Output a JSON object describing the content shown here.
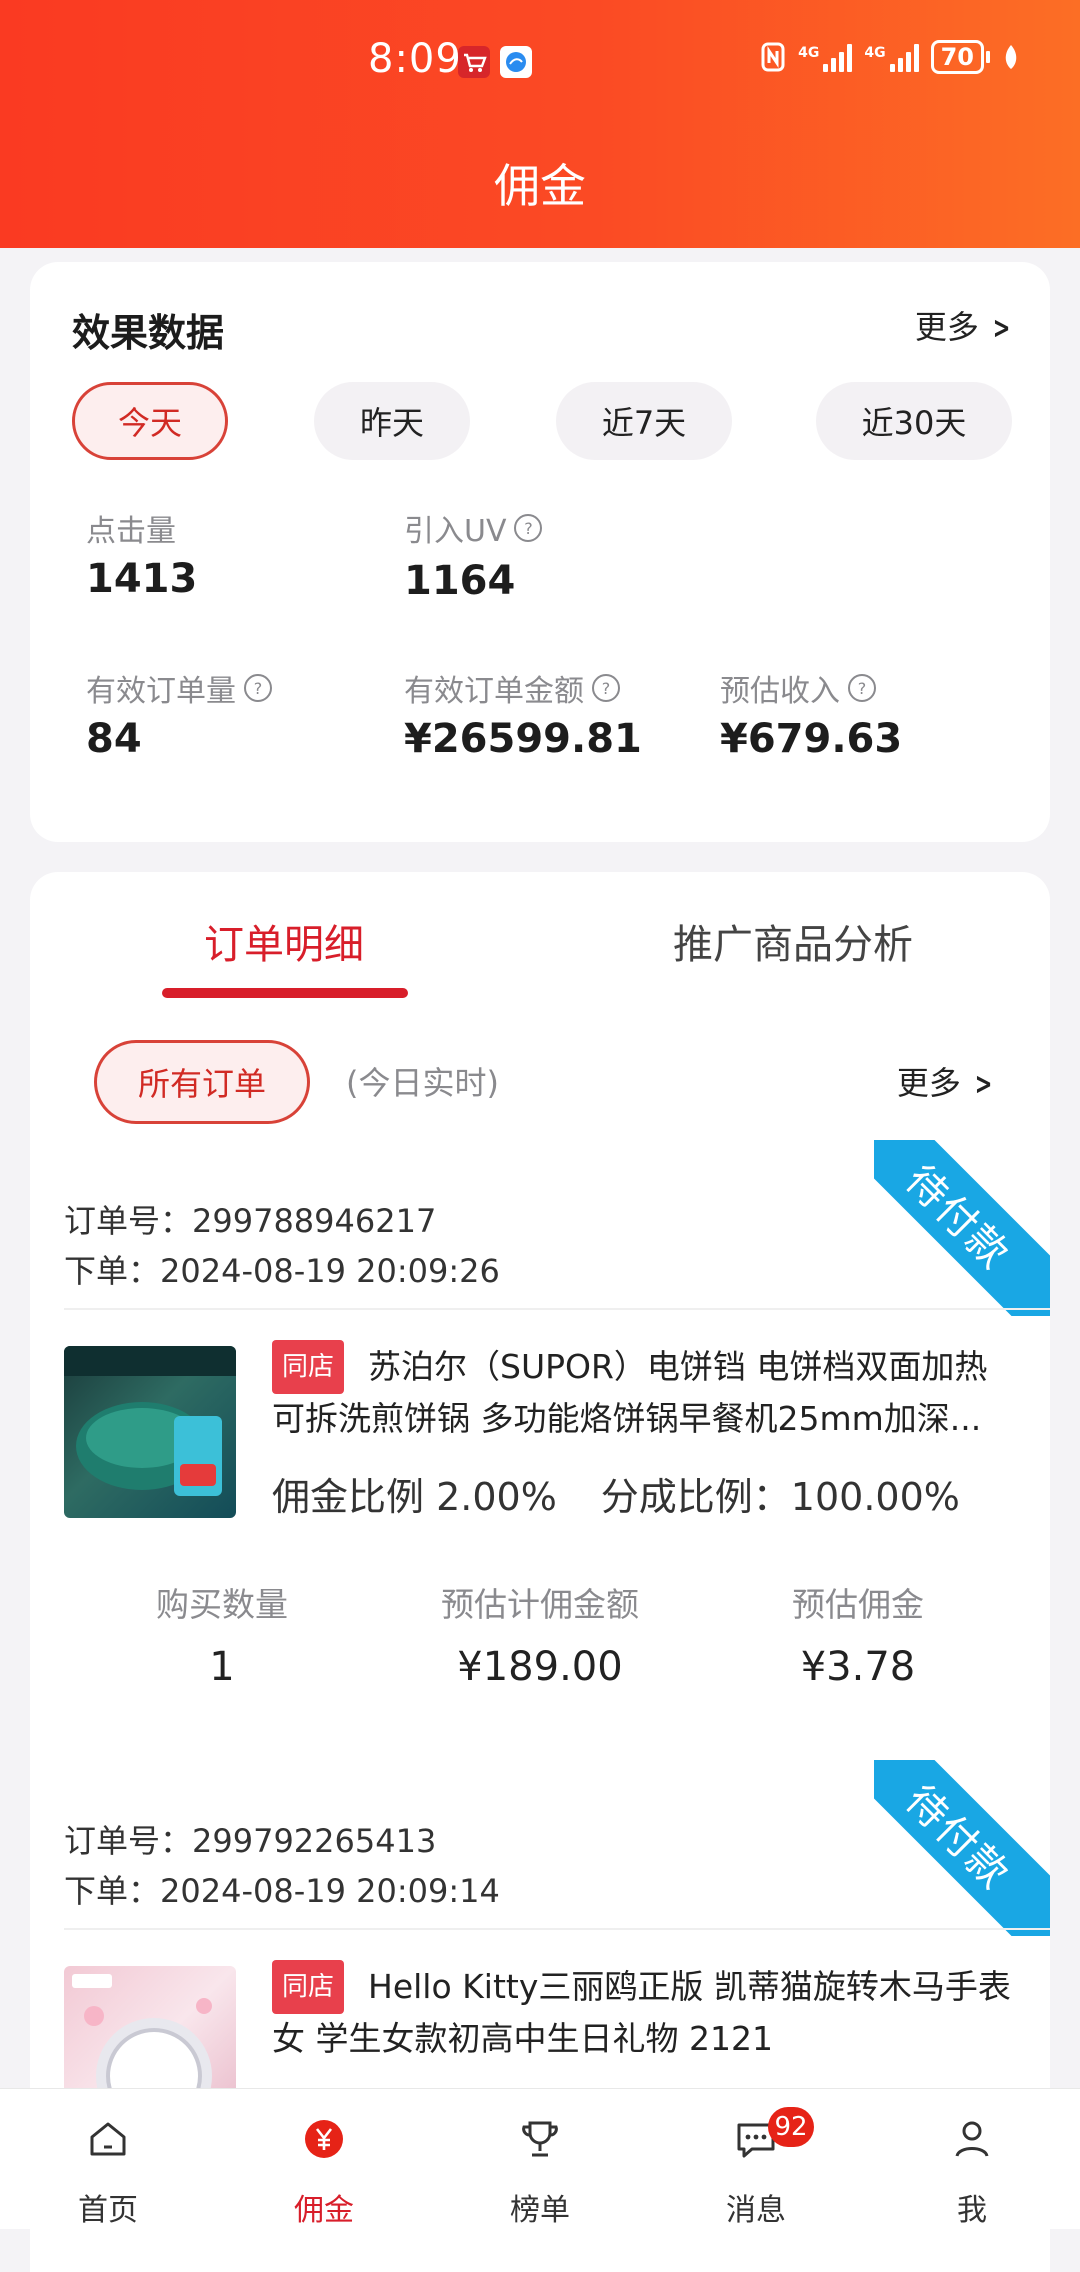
{
  "status_bar": {
    "time": "8:09",
    "battery": "70",
    "network_1": "4G",
    "network_2": "4G"
  },
  "page": {
    "title": "佣金"
  },
  "effect_card": {
    "title": "效果数据",
    "more": "更多",
    "periods": [
      "今天",
      "昨天",
      "近7天",
      "近30天"
    ],
    "selected_period": "今天",
    "stats": {
      "clicks": {
        "label": "点击量",
        "value": "1413"
      },
      "uv": {
        "label": "引入UV",
        "value": "1164"
      },
      "valid_orders": {
        "label": "有效订单量",
        "value": "84"
      },
      "valid_amount": {
        "label": "有效订单金额",
        "value": "¥26599.81"
      },
      "est_income": {
        "label": "预估收入",
        "value": "¥679.63"
      }
    }
  },
  "tabs": {
    "orders": "订单明细",
    "analysis": "推广商品分析",
    "active": "订单明细"
  },
  "filter": {
    "all_orders": "所有订单",
    "realtime": "(今日实时)",
    "more": "更多"
  },
  "orders": [
    {
      "order_no": "订单号：299788946217",
      "order_time": "下单：2024-08-19 20:09:26",
      "status": "待付款",
      "shop_badge": "同店",
      "title": "苏泊尔（SUPOR）电饼铛 电饼档双面加热可拆洗煎饼锅 多功能烙饼锅早餐机25mm加深...",
      "commission_rate": "佣金比例 2.00%",
      "share_rate": "分成比例：100.00%",
      "qty_label": "购买数量",
      "qty": "1",
      "base_label": "预估计佣金额",
      "base": "¥189.00",
      "commission_label": "预估佣金",
      "commission": "¥3.78"
    },
    {
      "order_no": "订单号：299792265413",
      "order_time": "下单：2024-08-19 20:09:14",
      "status": "待付款",
      "shop_badge": "同店",
      "title": "Hello Kitty三丽鸥正版 凯蒂猫旋转木马手表女 学生女款初高中生日礼物 2121"
    }
  ],
  "bottom_nav": [
    {
      "label": "首页",
      "icon": "home-icon"
    },
    {
      "label": "佣金",
      "icon": "yuan-icon"
    },
    {
      "label": "榜单",
      "icon": "trophy-icon"
    },
    {
      "label": "消息",
      "icon": "message-icon",
      "badge": "92"
    },
    {
      "label": "我",
      "icon": "person-icon"
    }
  ],
  "colors": {
    "accent": "#d81e2a",
    "header_start": "#fa3a22",
    "header_end": "#fc6e25",
    "ribbon": "#19a7e4"
  }
}
